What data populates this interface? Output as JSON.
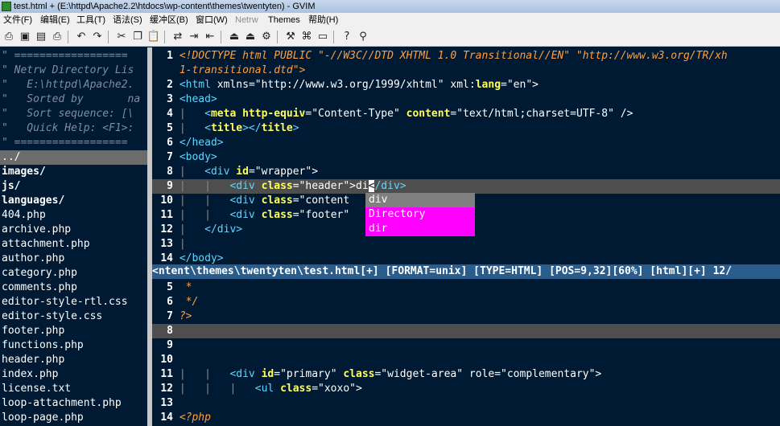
{
  "window": {
    "title": "test.html + (E:\\httpd\\Apache2.2\\htdocs\\wp-content\\themes\\twentyten) - GVIM"
  },
  "menubar": [
    {
      "label": "文件(F)",
      "disabled": false
    },
    {
      "label": "编辑(E)",
      "disabled": false
    },
    {
      "label": "工具(T)",
      "disabled": false
    },
    {
      "label": "语法(S)",
      "disabled": false
    },
    {
      "label": "缓冲区(B)",
      "disabled": false
    },
    {
      "label": "窗口(W)",
      "disabled": false
    },
    {
      "label": "Netrw",
      "disabled": true
    },
    {
      "label": "Themes",
      "disabled": false
    },
    {
      "label": "帮助(H)",
      "disabled": false
    }
  ],
  "toolbar": [
    {
      "name": "open-icon",
      "glyph": "⎙"
    },
    {
      "name": "save-icon",
      "glyph": "▣"
    },
    {
      "name": "save-all-icon",
      "glyph": "▤"
    },
    {
      "name": "print-icon",
      "glyph": "⎙"
    },
    {
      "name": "undo-icon",
      "glyph": "↶"
    },
    {
      "name": "redo-icon",
      "glyph": "↷"
    },
    {
      "name": "cut-icon",
      "glyph": "✂"
    },
    {
      "name": "copy-icon",
      "glyph": "❐"
    },
    {
      "name": "paste-icon",
      "glyph": "📋"
    },
    {
      "name": "replace-icon",
      "glyph": "⇄"
    },
    {
      "name": "find-next-icon",
      "glyph": "⇥"
    },
    {
      "name": "find-prev-icon",
      "glyph": "⇤"
    },
    {
      "name": "load-session-icon",
      "glyph": "⏏"
    },
    {
      "name": "save-session-icon",
      "glyph": "⏏"
    },
    {
      "name": "run-script-icon",
      "glyph": "⚙"
    },
    {
      "name": "make-icon",
      "glyph": "⚒"
    },
    {
      "name": "shell-icon",
      "glyph": "⌘"
    },
    {
      "name": "tags-icon",
      "glyph": "▭"
    },
    {
      "name": "help-icon",
      "glyph": "?"
    },
    {
      "name": "find-help-icon",
      "glyph": "⚲"
    }
  ],
  "netrw": {
    "header": [
      "\" ==================",
      "\" Netrw Directory Lis",
      "\"   E:\\httpd\\Apache2.",
      "\"   Sorted by       na",
      "\"   Sort sequence: [\\",
      "\"   Quick Help: <F1>:",
      "\" =================="
    ],
    "selected": "../",
    "dirs": [
      "images/",
      "js/",
      "languages/"
    ],
    "files": [
      "404.php",
      "archive.php",
      "attachment.php",
      "author.php",
      "category.php",
      "comments.php",
      "editor-style-rtl.css",
      "editor-style.css",
      "footer.php",
      "functions.php",
      "header.php",
      "index.php",
      "license.txt",
      "loop-attachment.php",
      "loop-page.php"
    ]
  },
  "editor_top": {
    "lines": [
      {
        "n": "1",
        "segs": [
          {
            "t": "<!DOCTYPE html PUBLIC \"-//W3C//DTD XHTML 1.0 Transitional//EN\" \"http://www.w3.org/TR/xh",
            "c": "doct"
          }
        ]
      },
      {
        "n": "",
        "segs": [
          {
            "t": "1-transitional.dtd\">",
            "c": "doct"
          }
        ]
      },
      {
        "n": "2",
        "segs": [
          {
            "t": "<",
            "c": "tag"
          },
          {
            "t": "html",
            "c": "tag"
          },
          {
            "t": " xmlns",
            "c": "str"
          },
          {
            "t": "=",
            "c": "str"
          },
          {
            "t": "\"http://www.w3.org/1999/xhtml\"",
            "c": "str"
          },
          {
            "t": " xml",
            "c": "str"
          },
          {
            "t": ":",
            "c": "str"
          },
          {
            "t": "lang",
            "c": "attr"
          },
          {
            "t": "=\"en\">",
            "c": "str"
          }
        ]
      },
      {
        "n": "3",
        "segs": [
          {
            "t": "<head>",
            "c": "tag"
          }
        ]
      },
      {
        "n": "4",
        "segs": [
          {
            "t": "|   ",
            "c": "pipe"
          },
          {
            "t": "<",
            "c": "tag"
          },
          {
            "t": "meta",
            "c": "attr"
          },
          {
            "t": " ",
            "c": "str"
          },
          {
            "t": "http-equiv",
            "c": "attr"
          },
          {
            "t": "=\"Content-Type\" ",
            "c": "str"
          },
          {
            "t": "content",
            "c": "attr"
          },
          {
            "t": "=\"text/html;charset=UTF-8\" />",
            "c": "str"
          }
        ]
      },
      {
        "n": "5",
        "segs": [
          {
            "t": "|   ",
            "c": "pipe"
          },
          {
            "t": "<",
            "c": "tag"
          },
          {
            "t": "title",
            "c": "attr"
          },
          {
            "t": "></",
            "c": "tag"
          },
          {
            "t": "title",
            "c": "attr"
          },
          {
            "t": ">",
            "c": "tag"
          }
        ]
      },
      {
        "n": "6",
        "segs": [
          {
            "t": "</head>",
            "c": "tag"
          }
        ]
      },
      {
        "n": "7",
        "segs": [
          {
            "t": "<body>",
            "c": "tag"
          }
        ]
      },
      {
        "n": "8",
        "segs": [
          {
            "t": "|   ",
            "c": "pipe"
          },
          {
            "t": "<div ",
            "c": "tag"
          },
          {
            "t": "id",
            "c": "attr"
          },
          {
            "t": "=\"wrapper\">",
            "c": "str"
          }
        ]
      },
      {
        "n": "9",
        "segs": [
          {
            "t": "|   |   ",
            "c": "pipe"
          },
          {
            "t": "<div ",
            "c": "tag"
          },
          {
            "t": "class",
            "c": "attr"
          },
          {
            "t": "=\"header\">di",
            "c": "str"
          },
          {
            "t": "<",
            "c": "cursor"
          },
          {
            "t": "/div>",
            "c": "tag"
          }
        ]
      },
      {
        "n": "10",
        "segs": [
          {
            "t": "|   |   ",
            "c": "pipe"
          },
          {
            "t": "<div ",
            "c": "tag"
          },
          {
            "t": "class",
            "c": "attr"
          },
          {
            "t": "=\"content",
            "c": "str"
          }
        ]
      },
      {
        "n": "11",
        "segs": [
          {
            "t": "|   |   ",
            "c": "pipe"
          },
          {
            "t": "<div ",
            "c": "tag"
          },
          {
            "t": "class",
            "c": "attr"
          },
          {
            "t": "=\"footer\"",
            "c": "str"
          }
        ]
      },
      {
        "n": "12",
        "segs": [
          {
            "t": "|   ",
            "c": "pipe"
          },
          {
            "t": "</div>",
            "c": "tag"
          }
        ]
      },
      {
        "n": "13",
        "segs": [
          {
            "t": "|",
            "c": "pipe"
          }
        ]
      },
      {
        "n": "14",
        "segs": [
          {
            "t": "</body>",
            "c": "tag"
          }
        ]
      }
    ],
    "cursor_line_index": 9
  },
  "completion": [
    "div",
    "Directory",
    "dir"
  ],
  "statusline": "<ntent\\themes\\twentyten\\test.html[+] [FORMAT=unix] [TYPE=HTML] [POS=9,32][60%] [html][+] 12/",
  "editor_bottom": {
    "lines": [
      {
        "n": "5",
        "segs": [
          {
            "t": " *",
            "c": "doct"
          }
        ]
      },
      {
        "n": "6",
        "segs": [
          {
            "t": " */",
            "c": "doct"
          }
        ]
      },
      {
        "n": "7",
        "segs": [
          {
            "t": "?>",
            "c": "doct"
          }
        ]
      },
      {
        "n": "8",
        "segs": []
      },
      {
        "n": "9",
        "segs": []
      },
      {
        "n": "10",
        "segs": []
      },
      {
        "n": "11",
        "segs": [
          {
            "t": "|   |   ",
            "c": "pipe"
          },
          {
            "t": "<div ",
            "c": "tag"
          },
          {
            "t": "id",
            "c": "attr"
          },
          {
            "t": "=\"primary\" ",
            "c": "str"
          },
          {
            "t": "class",
            "c": "attr"
          },
          {
            "t": "=\"widget-area\" role=\"complementary\">",
            "c": "str"
          }
        ]
      },
      {
        "n": "12",
        "segs": [
          {
            "t": "|   |   |   ",
            "c": "pipe"
          },
          {
            "t": "<ul ",
            "c": "tag"
          },
          {
            "t": "class",
            "c": "attr"
          },
          {
            "t": "=\"xoxo\">",
            "c": "str"
          }
        ]
      },
      {
        "n": "13",
        "segs": []
      },
      {
        "n": "14",
        "segs": [
          {
            "t": "<?php",
            "c": "doct"
          }
        ]
      }
    ],
    "cursor_line_index": 3
  }
}
